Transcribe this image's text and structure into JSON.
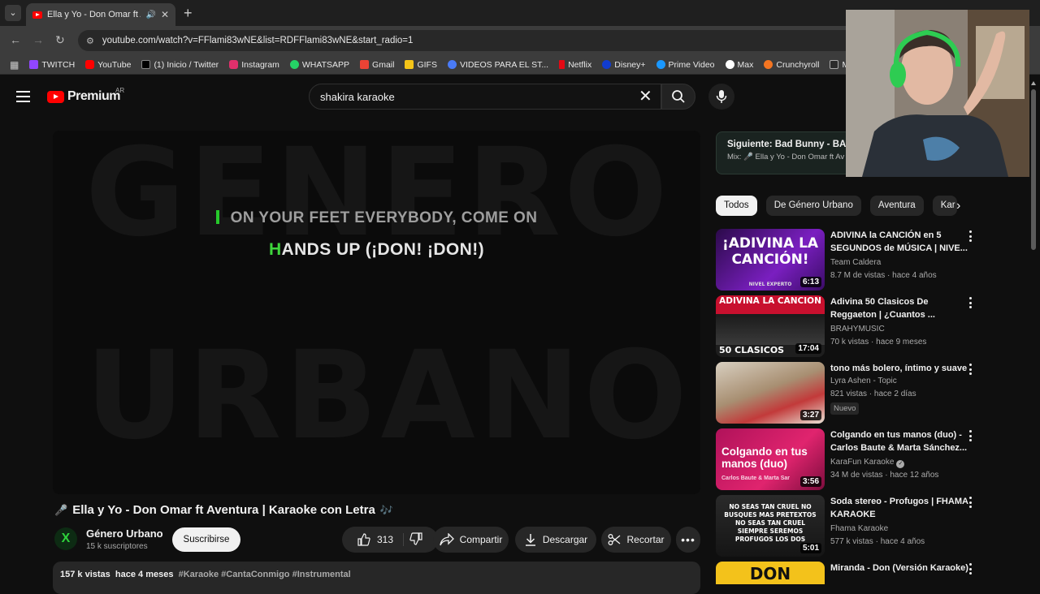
{
  "browser": {
    "tab_title": "Ella y Yo - Don Omar ft A",
    "url": "youtube.com/watch?v=FFlami83wNE&list=RDFFlami83wNE&start_radio=1",
    "bookmarks": [
      "TWITCH",
      "YouTube",
      "(1) Inicio / Twitter",
      "Instagram",
      "WHATSAPP",
      "Gmail",
      "GIFS",
      "VIDEOS PARA EL ST...",
      "Netflix",
      "Disney+",
      "Prime Video",
      "Max",
      "Crunchyroll",
      "MA"
    ]
  },
  "header": {
    "logo": "Premium",
    "region": "AR",
    "search_query": "shakira karaoke"
  },
  "player": {
    "lyric_line_1": "ON YOUR FEET EVERYBODY, COME ON",
    "lyric_line_2_highlight": "H",
    "lyric_line_2_rest": "ANDS UP (¡DON! ¡DON!)"
  },
  "video": {
    "title": "Ella y Yo - Don Omar ft Aventura | Karaoke con Letra",
    "channel": "Género Urbano",
    "subscribers": "15 k suscriptores",
    "subscribe_label": "Suscribirse",
    "likes": "313",
    "share_label": "Compartir",
    "download_label": "Descargar",
    "clip_label": "Recortar",
    "views": "157 k vistas",
    "age": "hace 4 meses",
    "tags": "#Karaoke #CantaConmigo #Instrumental"
  },
  "sidebar": {
    "next_title": "Siguiente: Bad Bunny - BAILE",
    "next_mix": "Mix: 🎤 Ella y Yo - Don Omar ft Av",
    "chips": [
      "Todos",
      "De Género Urbano",
      "Aventura",
      "Kar"
    ],
    "items": [
      {
        "title": "ADIVINA la CANCIÓN en 5 SEGUNDOS de MÚSICA | NIVE...",
        "channel": "Team Caldera",
        "meta": "8.7 M de vistas · hace 4 años",
        "duration": "6:13",
        "thumb_text": "¡ADIVINA LA CANCIÓN!",
        "thumb_sub": "NIVEL EXPERTO",
        "new": ""
      },
      {
        "title": "Adivina 50 Clasicos De Reggaeton | ¿Cuantos ...",
        "channel": "BRAHYMUSIC",
        "meta": "70 k vistas · hace 9 meses",
        "duration": "17:04",
        "thumb_text": "ADIVINA LA CANCION",
        "thumb_sub": "50 CLASICOS",
        "new": ""
      },
      {
        "title": "tono más bolero, íntimo y suave",
        "channel": "Lyra Ashen - Topic",
        "meta": "821 vistas · hace 2 días",
        "duration": "3:27",
        "thumb_text": "",
        "thumb_sub": "",
        "new": "Nuevo"
      },
      {
        "title": "Colgando en tus manos (duo) - Carlos Baute & Marta Sánchez...",
        "channel": "KaraFun Karaoke",
        "meta": "34 M de vistas · hace 12 años",
        "duration": "3:56",
        "thumb_text": "Colgando en tus manos (duo)",
        "thumb_sub": "Carlos Baute & Marta Sar",
        "new": ""
      },
      {
        "title": "Soda stereo - Profugos | FHAMA KARAOKE",
        "channel": "Fhama Karaoke",
        "meta": "577 k vistas · hace 4 años",
        "duration": "5:01",
        "thumb_text": "NO SEAS TAN CRUEL NO BUSQUES MAS PRETEXTOS NO SEAS TAN CRUEL SIEMPRE SEREMOS PROFUGOS LOS DOS",
        "thumb_sub": "",
        "new": ""
      },
      {
        "title": "Miranda - Don (Versión Karaoke)",
        "channel": "",
        "meta": "",
        "duration": "",
        "thumb_text": "DON",
        "thumb_sub": "",
        "new": ""
      }
    ]
  }
}
